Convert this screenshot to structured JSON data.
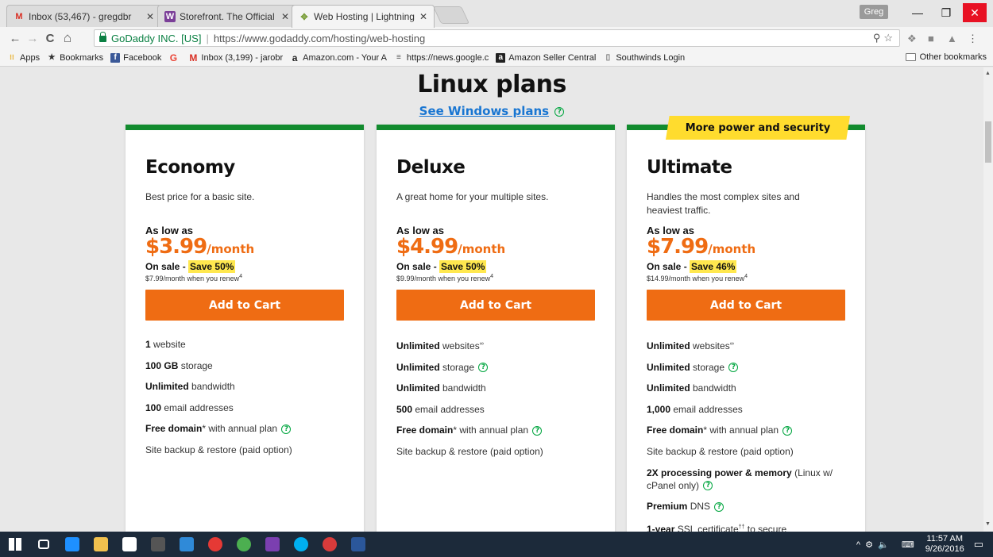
{
  "tabs": [
    {
      "title": "Inbox (53,467) - gregdbr",
      "favicon": "gmail-icon",
      "color": "#d93025",
      "glyph": "M"
    },
    {
      "title": "Storefront. The Official W",
      "favicon": "w-icon",
      "color": "#7b3f98",
      "glyph": "W"
    },
    {
      "title": "Web Hosting | Lightning",
      "favicon": "godaddy-icon",
      "color": "#7a9e3a",
      "glyph": "✥"
    }
  ],
  "window": {
    "profile": "Greg",
    "minimize": "—",
    "restore": "❐",
    "close": "✕"
  },
  "toolbar": {
    "back": "←",
    "forward": "→",
    "reload": "C",
    "home": "⌂",
    "secure_label": "GoDaddy INC. [US]",
    "separator": "|",
    "url": "https://www.godaddy.com/hosting/web-hosting",
    "zoom_star": "⚲☆"
  },
  "bookmarks": {
    "items": [
      {
        "label": "Apps",
        "icon": "apps-grid-icon",
        "color": "#e5a100",
        "glyph": "⁝⁝"
      },
      {
        "label": "Bookmarks",
        "icon": "star-icon",
        "color": "#333",
        "glyph": "★"
      },
      {
        "label": "Facebook",
        "icon": "facebook-icon",
        "color": "#3b5998",
        "glyph": "f"
      },
      {
        "label": "",
        "icon": "google-icon",
        "color": "#ea4335",
        "glyph": "G"
      },
      {
        "label": "Inbox (3,199) - jarobr",
        "icon": "gmail-icon",
        "color": "#d93025",
        "glyph": "M"
      },
      {
        "label": "Amazon.com - Your A",
        "icon": "amazon-icon",
        "color": "#222",
        "glyph": "a"
      },
      {
        "label": "https://news.google.c",
        "icon": "news-icon",
        "color": "#555",
        "glyph": "≡"
      },
      {
        "label": "Amazon Seller Central",
        "icon": "amazon-seller-icon",
        "color": "#222",
        "glyph": "a"
      },
      {
        "label": "Southwinds Login",
        "icon": "page-icon",
        "color": "#888",
        "glyph": "▯"
      }
    ],
    "other": "Other bookmarks"
  },
  "page": {
    "heading": "Linux plans",
    "windows_link": "See Windows plans",
    "help_glyph": "?",
    "ribbon": "More power and security"
  },
  "plans": [
    {
      "name": "Economy",
      "desc": "Best price for a basic site.",
      "as_low": "As low as",
      "price": "$3.99",
      "per": "/month",
      "sale_prefix": "On sale - ",
      "save": "Save 50%",
      "renew": "$7.99/month when you renew",
      "renew_sup": "4",
      "cta": "Add to Cart",
      "features": [
        {
          "bold": "1",
          "rest": " website",
          "help": false
        },
        {
          "bold": "100 GB",
          "rest": " storage",
          "help": false
        },
        {
          "bold": "Unlimited",
          "rest": " bandwidth",
          "help": false
        },
        {
          "bold": "100",
          "rest": " email addresses",
          "help": false
        },
        {
          "bold": "Free domain",
          "rest": "* with annual plan",
          "help": true
        },
        {
          "bold": "",
          "rest": "Site backup & restore (paid option)",
          "help": false
        }
      ]
    },
    {
      "name": "Deluxe",
      "desc": "A great home for your multiple sites.",
      "as_low": "As low as",
      "price": "$4.99",
      "per": "/month",
      "sale_prefix": "On sale - ",
      "save": "Save 50%",
      "renew": "$9.99/month when you renew",
      "renew_sup": "4",
      "cta": "Add to Cart",
      "features": [
        {
          "bold": "Unlimited",
          "rest": " websites",
          "sup": "∞",
          "help": false
        },
        {
          "bold": "Unlimited",
          "rest": " storage",
          "help": true
        },
        {
          "bold": "Unlimited",
          "rest": " bandwidth",
          "help": false
        },
        {
          "bold": "500",
          "rest": " email addresses",
          "help": false
        },
        {
          "bold": "Free domain",
          "rest": "* with annual plan",
          "help": true
        },
        {
          "bold": "",
          "rest": "Site backup & restore (paid option)",
          "help": false
        }
      ]
    },
    {
      "name": "Ultimate",
      "desc": "Handles the most complex sites and heaviest traffic.",
      "as_low": "As low as",
      "price": "$7.99",
      "per": "/month",
      "sale_prefix": "On sale - ",
      "save": "Save 46%",
      "renew": "$14.99/month when you renew",
      "renew_sup": "4",
      "cta": "Add to Cart",
      "features": [
        {
          "bold": "Unlimited",
          "rest": " websites",
          "sup": "∞",
          "help": false
        },
        {
          "bold": "Unlimited",
          "rest": " storage",
          "help": true
        },
        {
          "bold": "Unlimited",
          "rest": " bandwidth",
          "help": false
        },
        {
          "bold": "1,000",
          "rest": " email addresses",
          "help": false
        },
        {
          "bold": "Free domain",
          "rest": "* with annual plan",
          "help": true
        },
        {
          "bold": "",
          "rest": "Site backup & restore (paid option)",
          "help": false
        },
        {
          "bold": "2X processing power & memory",
          "rest": " (Linux w/ cPanel only)",
          "help": true
        },
        {
          "bold": "Premium",
          "rest": " DNS",
          "help": true
        },
        {
          "bold": "1-year",
          "rest": " SSL certificate",
          "sup": "††",
          "rest2": " to secure",
          "help": false
        }
      ]
    }
  ],
  "taskbar": {
    "apps": [
      {
        "icon": "windows-start-icon",
        "color": "#ffffff"
      },
      {
        "icon": "task-view-icon",
        "color": "#ffffff"
      },
      {
        "icon": "edge-icon",
        "color": "#1e90ff"
      },
      {
        "icon": "file-explorer-icon",
        "color": "#f2c14e"
      },
      {
        "icon": "store-icon",
        "color": "#ffffff"
      },
      {
        "icon": "pen-app-icon",
        "color": "#555555"
      },
      {
        "icon": "photo-app-icon",
        "color": "#2f8ad8"
      },
      {
        "icon": "cloud-app-icon",
        "color": "#e53935"
      },
      {
        "icon": "chrome-icon",
        "color": "#4caf50"
      },
      {
        "icon": "calculator-icon",
        "color": "#7b3fb0"
      },
      {
        "icon": "skype-icon",
        "color": "#00aff0"
      },
      {
        "icon": "mail-app-icon",
        "color": "#d83b3b"
      },
      {
        "icon": "word-icon",
        "color": "#2b579a"
      }
    ],
    "tray_glyphs": "^  ⚙  🔈  ",
    "time": "11:57 AM",
    "date": "9/26/2016"
  }
}
